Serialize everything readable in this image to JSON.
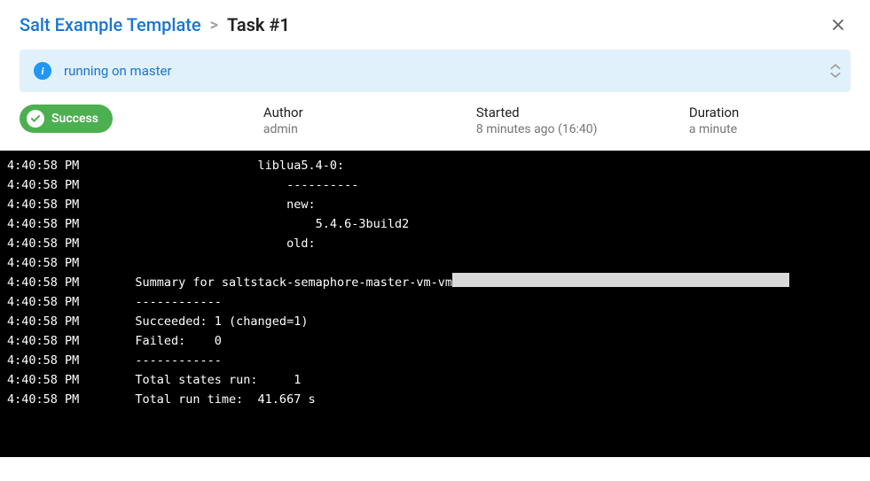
{
  "breadcrumb": {
    "parent": "Salt Example Template",
    "separator": ">",
    "current": "Task #1"
  },
  "banner": {
    "message": "running on master"
  },
  "status": {
    "label": "Success"
  },
  "meta": {
    "author": {
      "label": "Author",
      "value": "admin"
    },
    "started": {
      "label": "Started",
      "value": "8 minutes ago (16:40)"
    },
    "duration": {
      "label": "Duration",
      "value": "a minute"
    }
  },
  "terminal": {
    "lines": [
      {
        "ts": "4:40:58 PM",
        "text": "                    liblua5.4-0:"
      },
      {
        "ts": "4:40:58 PM",
        "text": "                        ----------"
      },
      {
        "ts": "4:40:58 PM",
        "text": "                        new:"
      },
      {
        "ts": "4:40:58 PM",
        "text": "                            5.4.6-3build2"
      },
      {
        "ts": "4:40:58 PM",
        "text": "                        old:"
      },
      {
        "ts": "4:40:58 PM",
        "text": ""
      },
      {
        "ts": "4:40:58 PM",
        "text": "   Summary for saltstack-semaphore-master-vm-vm",
        "highlight": true
      },
      {
        "ts": "4:40:58 PM",
        "text": "   ------------"
      },
      {
        "ts": "4:40:58 PM",
        "text": "   Succeeded: 1 (changed=1)"
      },
      {
        "ts": "4:40:58 PM",
        "text": "   Failed:    0"
      },
      {
        "ts": "4:40:58 PM",
        "text": "   ------------"
      },
      {
        "ts": "4:40:58 PM",
        "text": "   Total states run:     1"
      },
      {
        "ts": "4:40:58 PM",
        "text": "   Total run time:  41.667 s"
      }
    ]
  }
}
